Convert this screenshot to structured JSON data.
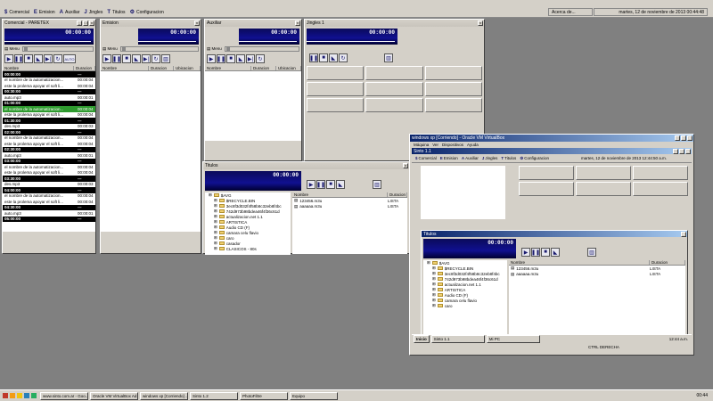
{
  "app": {
    "menu": [
      {
        "icon": "$",
        "label": "Comercial"
      },
      {
        "icon": "E",
        "label": "Emision"
      },
      {
        "icon": "A",
        "label": "Auxiliar"
      },
      {
        "icon": "J",
        "label": "Jingles"
      },
      {
        "icon": "T",
        "label": "Titulos"
      },
      {
        "icon": "⚙",
        "label": "Configuracion"
      }
    ],
    "about": "Acerca de...",
    "datetime": "martes, 12 de noviembre de 2013 00:44:48"
  },
  "comercial": {
    "title": "Comercial - PARETEX",
    "time": "00:00:00",
    "menu": "Menu",
    "col_name": "Nombre",
    "col_dur": "Duracion",
    "auto": "AUTO",
    "rows": [
      {
        "n": "00:00:00",
        "d": "---",
        "t": "hour"
      },
      {
        "n": "el nombre de la automatizacion...",
        "d": "00:00:04",
        "t": ""
      },
      {
        "n": "este la prolema apoyar el soft li...",
        "d": "00:00:04",
        "t": ""
      },
      {
        "n": "00:30:00",
        "d": "---",
        "t": "hour"
      },
      {
        "n": "auto.mp3",
        "d": "00:00:01",
        "t": ""
      },
      {
        "n": "01:00:00",
        "d": "---",
        "t": "hour"
      },
      {
        "n": "el nombre de la automatizacion...",
        "d": "00:00:04",
        "t": "sel"
      },
      {
        "n": "este la prolema apoyar el soft li...",
        "d": "00:00:04",
        "t": ""
      },
      {
        "n": "01:30:00",
        "d": "---",
        "t": "hour"
      },
      {
        "n": "des.mp3",
        "d": "00:00:03",
        "t": ""
      },
      {
        "n": "02:00:00",
        "d": "---",
        "t": "hour"
      },
      {
        "n": "el nombre de la automatizacion...",
        "d": "00:00:04",
        "t": ""
      },
      {
        "n": "este la prolema apoyar el soft li...",
        "d": "00:00:04",
        "t": ""
      },
      {
        "n": "02:30:00",
        "d": "---",
        "t": "hour"
      },
      {
        "n": "auto.mp3",
        "d": "00:00:01",
        "t": ""
      },
      {
        "n": "03:00:00",
        "d": "---",
        "t": "hour"
      },
      {
        "n": "el nombre de la automatizacion...",
        "d": "00:00:04",
        "t": ""
      },
      {
        "n": "este la prolema apoyar el soft li...",
        "d": "00:00:04",
        "t": ""
      },
      {
        "n": "03:30:00",
        "d": "---",
        "t": "hour"
      },
      {
        "n": "des.mp3",
        "d": "00:00:03",
        "t": ""
      },
      {
        "n": "04:00:00",
        "d": "---",
        "t": "hour"
      },
      {
        "n": "el nombre de la automatizacion...",
        "d": "00:00:04",
        "t": ""
      },
      {
        "n": "este la prolema apoyar el soft li...",
        "d": "00:00:04",
        "t": ""
      },
      {
        "n": "04:30:00",
        "d": "---",
        "t": "hour"
      },
      {
        "n": "auto.mp3",
        "d": "00:00:01",
        "t": ""
      },
      {
        "n": "05:00:00",
        "d": "---",
        "t": "hour"
      }
    ]
  },
  "emision": {
    "title": "Emision",
    "time": "00:00:00",
    "menu": "Menu",
    "cols": [
      "Nombre",
      "Duracion",
      "Ubicacion"
    ]
  },
  "auxiliar": {
    "title": "Auxiliar",
    "time": "00:00:00",
    "menu": "Menu",
    "cols": [
      "Nombre",
      "Duracion",
      "Ubicacion"
    ]
  },
  "jingles": {
    "title": "Jingles 1",
    "time": "00:00:00"
  },
  "titulos": {
    "title": "Titulos",
    "time": "00:00:00",
    "tree": [
      "$AVG",
      "$RECYCLE.BIN",
      "3ec8f3d032f4f58b8c32eb8f4bc",
      "742d973b98bdea46f4f36c61d",
      "actualizacion.net 1.1",
      "ARTISTICA",
      "Audio CD (F)",
      "camara celu flavio",
      "caro",
      "casador",
      "CLASICOS - 80s"
    ],
    "cols": [
      "Nombre",
      "Duracion"
    ],
    "files": [
      {
        "n": "123456.m3u",
        "d": "LISTA"
      },
      {
        "n": "aaaaaa.m3u",
        "d": "LISTA"
      }
    ]
  },
  "vm": {
    "title": "windows xp [Corriendo] - Oracle VM VirtualBox",
    "menu": [
      "Máquina",
      "Ver",
      "Dispositivos",
      "Ayuda"
    ],
    "inner_title": "Sinto 1.1",
    "inner_menu": [
      {
        "icon": "$",
        "label": "Comercial"
      },
      {
        "icon": "E",
        "label": "Emision"
      },
      {
        "icon": "A",
        "label": "Auxiliar"
      },
      {
        "icon": "J",
        "label": "Jingles"
      },
      {
        "icon": "T",
        "label": "Titulos"
      },
      {
        "icon": "⚙",
        "label": "Configuracion"
      }
    ],
    "datetime": "martes, 12 de noviembre de 2013 12:44:50 a.m.",
    "titulos_title": "Titulos",
    "time": "00:00:00",
    "tree": [
      "$AVG",
      "$RECYCLE.BIN",
      "3ec8f3d032f4f58b8c32eb8f4bc",
      "742d973b98bdea46f4f36c61d",
      "actualizacion.net 1.1",
      "ARTISTICA",
      "Audio CD (F)",
      "camara celu flavio",
      "caro"
    ],
    "cols": [
      "Nombre",
      "Duracion"
    ],
    "files": [
      {
        "n": "123456.m3u",
        "d": "LISTA"
      },
      {
        "n": "aaaaaa.m3u",
        "d": "LISTA"
      }
    ],
    "start": "Inicio",
    "tasks": [
      "Sinto 1.1",
      "Mi PC"
    ],
    "clock": "12:44 a.m.",
    "hostkey": "CTRL DERECHA"
  },
  "taskbar": {
    "tasks": [
      "www.sinto.com.ar - Goo...",
      "Oracle VM VirtualBox Ad...",
      "windows xp [Corriendo] ...",
      "Sinto 1.2",
      "PhotoFiltre",
      "Equipo"
    ],
    "clock": "00:44"
  }
}
